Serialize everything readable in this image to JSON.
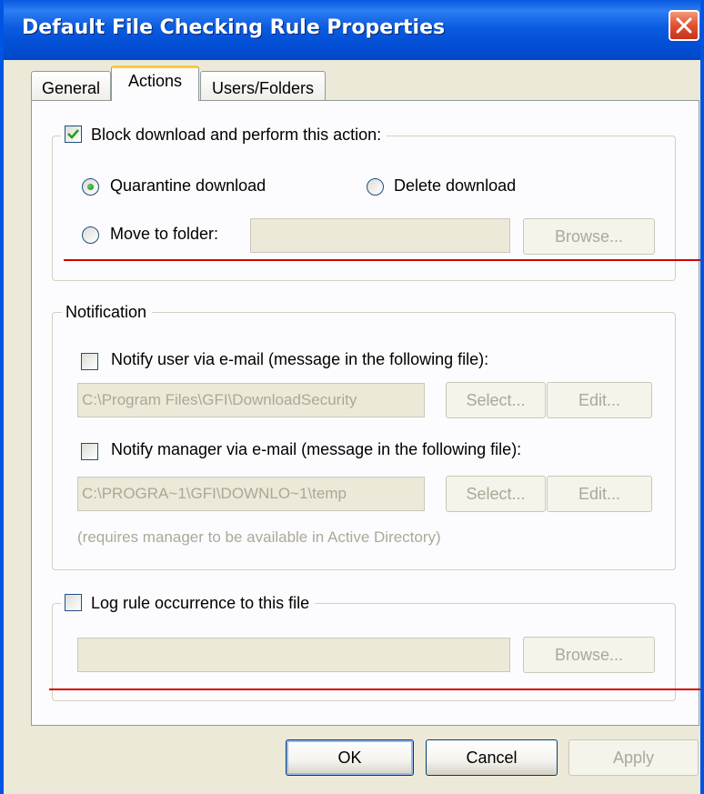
{
  "window": {
    "title": "Default File Checking Rule Properties"
  },
  "tabs": [
    {
      "label": "General",
      "active": false
    },
    {
      "label": "Actions",
      "active": true
    },
    {
      "label": "Users/Folders",
      "active": false
    }
  ],
  "block_group": {
    "checkbox_label": "Block download and perform this action:",
    "checked": true,
    "quarantine_label": "Quarantine download",
    "delete_label": "Delete download",
    "move_label": "Move to folder:",
    "selected_option": "Quarantine download",
    "move_folder_value": "",
    "browse_label": "Browse..."
  },
  "notification_group": {
    "legend": "Notification",
    "notify_user_label": "Notify user via e-mail (message in the following file):",
    "notify_user_checked": false,
    "user_file_value": "C:\\Program Files\\GFI\\DownloadSecurity",
    "notify_manager_label": "Notify manager via e-mail (message in the following file):",
    "notify_manager_checked": false,
    "manager_file_value": "C:\\PROGRA~1\\GFI\\DOWNLO~1\\temp",
    "select_label": "Select...",
    "edit_label": "Edit...",
    "manager_note": "(requires manager to be available in Active Directory)"
  },
  "log_group": {
    "checkbox_label": "Log rule occurrence to this file",
    "checked": false,
    "file_value": "",
    "browse_label": "Browse..."
  },
  "footer": {
    "ok_label": "OK",
    "cancel_label": "Cancel",
    "apply_label": "Apply"
  },
  "colors": {
    "titlebar": "#0054e3",
    "dialog_bg": "#ece9d8",
    "annotation_line": "#d40000"
  }
}
